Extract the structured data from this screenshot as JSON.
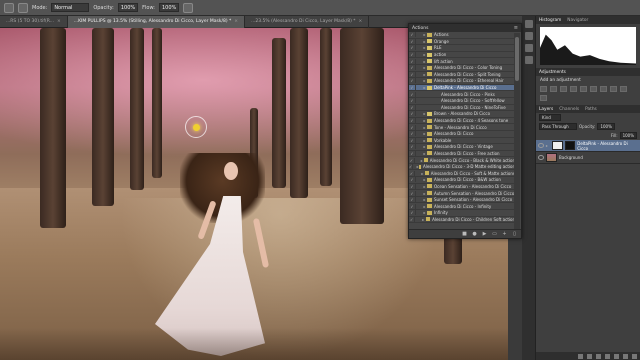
{
  "options_bar": {
    "mode_label": "Mode:",
    "mode_value": "Normal",
    "opacity_label": "Opacity:",
    "opacity_value": "100%",
    "flow_label": "Flow:",
    "flow_value": "100%"
  },
  "document_tabs": [
    {
      "label": "...RS (5 TO 30).tif(R...",
      "active": false
    },
    {
      "label": "...KIM PULLIPS @ 13.5% (Stilling, Alessandro Di Cicco, Layer Mask/8) *",
      "active": true
    },
    {
      "label": "...23.5% (Alessandro Di Cicco, Layer Mask/8) *",
      "active": false
    }
  ],
  "actions_panel": {
    "tab_label": "Actions",
    "rows": [
      {
        "label": "Actions",
        "type": "folder",
        "selected": false
      },
      {
        "label": "Orange",
        "type": "item",
        "selected": false
      },
      {
        "label": "RLE",
        "type": "item",
        "selected": false
      },
      {
        "label": "action",
        "type": "item",
        "selected": false
      },
      {
        "label": "lift action",
        "type": "item",
        "selected": false
      },
      {
        "label": "Alessandro Di Cicco - Color Toning",
        "type": "folder",
        "selected": false
      },
      {
        "label": "Alessandro Di Cicco - Split Toning",
        "type": "folder",
        "selected": false
      },
      {
        "label": "Alessandro Di Cicco - Ethereal Hair",
        "type": "folder",
        "selected": false
      },
      {
        "label": "DeltaPink - Alessandro Di Cicco",
        "type": "item",
        "selected": true
      },
      {
        "label": "Alessandro Di Cicco - Pinks",
        "type": "sub",
        "selected": false
      },
      {
        "label": "Alessandro Di Cicco - SoftYellow",
        "type": "sub",
        "selected": false
      },
      {
        "label": "Alessandro Di Cicco - NineToFive",
        "type": "sub",
        "selected": false
      },
      {
        "label": "Brown - Alessandro Di Cicco",
        "type": "item",
        "selected": false
      },
      {
        "label": "Alessandro Di Cicco - 4 Seasons tone",
        "type": "folder",
        "selected": false
      },
      {
        "label": "Tone - Alessandro Di Cicco",
        "type": "folder",
        "selected": false
      },
      {
        "label": "Alessandro Di Cicco",
        "type": "folder",
        "selected": false
      },
      {
        "label": "Vorkable",
        "type": "folder",
        "selected": false
      },
      {
        "label": "Alessandro Di Cicco - Vintage",
        "type": "folder",
        "selected": false
      },
      {
        "label": "Alessandro Di Cicco - Free action",
        "type": "folder",
        "selected": false
      },
      {
        "label": "Alessandro Di Cicco - Black & White action",
        "type": "folder",
        "selected": false
      },
      {
        "label": "Alessandro Di Cicco - 3-D Matte editing action",
        "type": "folder",
        "selected": false
      },
      {
        "label": "Alessandro Di Cicco - Soft & Matte actions",
        "type": "folder",
        "selected": false
      },
      {
        "label": "Alessandro Di Cicco - B&W action",
        "type": "folder",
        "selected": false
      },
      {
        "label": "Ocean Sensation - Alessandro Di Cicco",
        "type": "folder",
        "selected": false
      },
      {
        "label": "Autumn Sensation - Alessandro Di Cicco",
        "type": "folder",
        "selected": false
      },
      {
        "label": "Sunset Sensation - Alessandro Di Cicco",
        "type": "folder",
        "selected": false
      },
      {
        "label": "Alessandro Di Cicco - Infinity",
        "type": "folder",
        "selected": false
      },
      {
        "label": "Infinity",
        "type": "folder",
        "selected": false
      },
      {
        "label": "Alessandro Di Cicco - Children Soft action",
        "type": "folder",
        "selected": false
      }
    ]
  },
  "histogram_panel": {
    "tab_label": "Histogram",
    "tab2_label": "Navigator"
  },
  "adjustments_panel": {
    "tab_label": "Adjustments",
    "title": "Add an adjustment"
  },
  "layers_panel": {
    "tab_label": "Layers",
    "tab2_label": "Channels",
    "tab3_label": "Paths",
    "kind_value": "Kind",
    "blend_value": "Pass Through",
    "opacity_label": "Opacity:",
    "opacity_value": "100%",
    "fill_label": "Fill:",
    "fill_value": "100%",
    "layers": [
      {
        "label": "DeltaPink - Alessandro Di Cicco",
        "active": true
      },
      {
        "label": "Background",
        "active": false
      }
    ]
  }
}
